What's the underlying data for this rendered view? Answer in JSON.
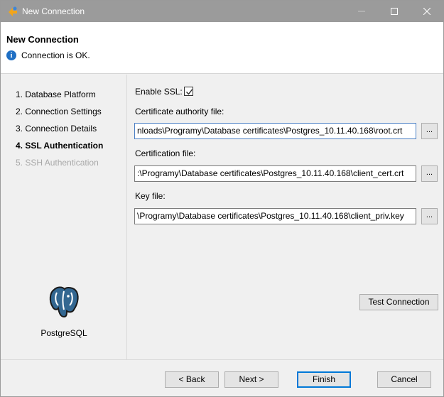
{
  "window": {
    "title": "New Connection"
  },
  "header": {
    "title": "New Connection",
    "status": "Connection is OK."
  },
  "sidebar": {
    "items": [
      {
        "label": "1. Database Platform",
        "state": "normal"
      },
      {
        "label": "2. Connection Settings",
        "state": "normal"
      },
      {
        "label": "3. Connection Details",
        "state": "normal"
      },
      {
        "label": "4. SSL Authentication",
        "state": "active"
      },
      {
        "label": "5. SSH Authentication",
        "state": "disabled"
      }
    ],
    "platform_label": "PostgreSQL"
  },
  "ssl": {
    "enable_label": "Enable SSL:",
    "enabled": true,
    "ca_label": "Certificate authority file:",
    "ca_value": "nloads\\Programy\\Database certificates\\Postgres_10.11.40.168\\root.crt",
    "cert_label": "Certification file:",
    "cert_value": ":\\Programy\\Database certificates\\Postgres_10.11.40.168\\client_cert.crt",
    "key_label": "Key file:",
    "key_value": "\\Programy\\Database certificates\\Postgres_10.11.40.168\\client_priv.key",
    "browse_label": "...",
    "test_label": "Test Connection"
  },
  "footer": {
    "back_label": "< Back",
    "next_label": "Next >",
    "finish_label": "Finish",
    "cancel_label": "Cancel"
  },
  "colors": {
    "accent": "#0078d7",
    "titlebar": "#9b9b9b",
    "info": "#1f6fc4"
  }
}
